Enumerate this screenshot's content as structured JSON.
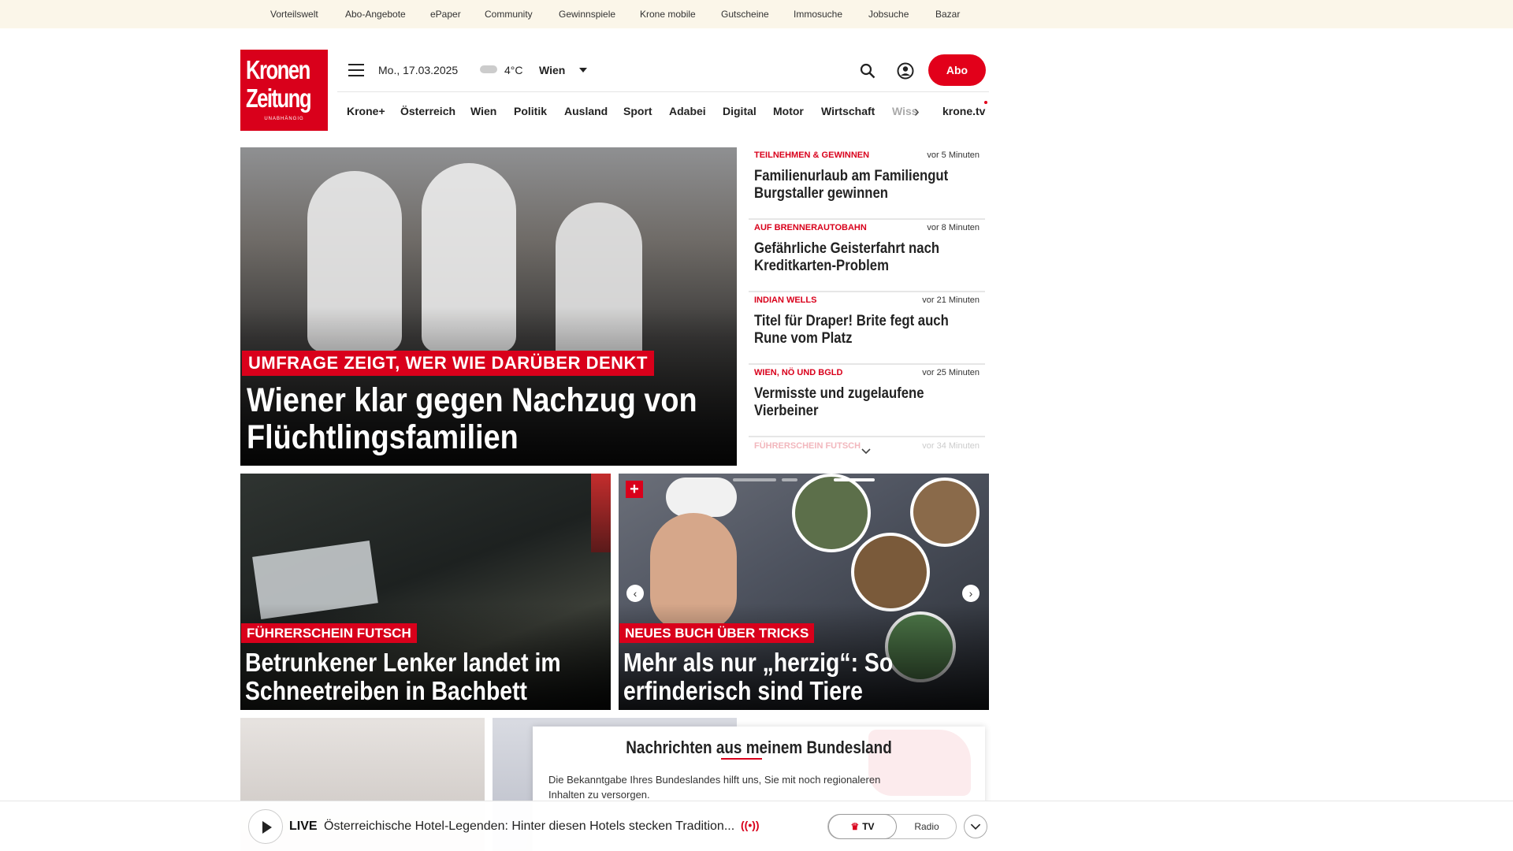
{
  "topnav": [
    "Vorteilswelt",
    "Abo-Angebote",
    "ePaper",
    "Community",
    "Gewinnspiele",
    "Krone mobile",
    "Gutscheine",
    "Immosuche",
    "Jobsuche",
    "Bazar"
  ],
  "logo": {
    "line1": "Kronen",
    "line2": "Zeitung",
    "tagline": "UNABHÄNGIG"
  },
  "header": {
    "date": "Mo., 17.03.2025",
    "temperature": "4°C",
    "location": "Wien",
    "abo_label": "Abo"
  },
  "mainnav": [
    "Krone+",
    "Österreich",
    "Wien",
    "Politik",
    "Ausland",
    "Sport",
    "Adabei",
    "Digital",
    "Motor",
    "Wirtschaft",
    "Wiss"
  ],
  "mainnav_tv": "krone.tv",
  "hero": {
    "kicker": "UMFRAGE ZEIGT, WER WIE DARÜBER DENKT",
    "title": "Wiener klar gegen Nachzug von Flüchtlingsfamilien"
  },
  "feed": [
    {
      "category": "TEILNEHMEN & GEWINNEN",
      "time": "vor 5 Minuten",
      "headline": "Familienurlaub am Familiengut Burgstaller gewinnen"
    },
    {
      "category": "AUF BRENNERAUTOBAHN",
      "time": "vor 8 Minuten",
      "headline": "Gefährliche Geisterfahrt nach Kreditkarten-Problem"
    },
    {
      "category": "INDIAN WELLS",
      "time": "vor 21 Minuten",
      "headline": "Titel für Draper! Brite fegt auch Rune vom Platz"
    },
    {
      "category": "WIEN, NÖ UND BGLD",
      "time": "vor 25 Minuten",
      "headline": "Vermisste und zugelaufene Vierbeiner"
    }
  ],
  "feed_partial": {
    "category": "FÜHRERSCHEIN FUTSCH",
    "time": "vor 34 Minuten"
  },
  "cards": [
    {
      "kicker": "FÜHRERSCHEIN FUTSCH",
      "title": "Betrunkener Lenker landet im Schneetreiben in Bachbett"
    },
    {
      "kicker": "NEUES BUCH ÜBER TRICKS",
      "title": "Mehr als nur „herzig“: So erfinderisch sind Tiere"
    }
  ],
  "plus_badge": "+",
  "bundesland_popup": {
    "title": "Nachrichten aus meinem Bundesland",
    "text": "Die Bekanntgabe Ihres Bundeslandes hilft uns, Sie mit noch regionaleren Inhalten zu versorgen."
  },
  "live_player": {
    "live_label": "LIVE",
    "text": "Österreichische Hotel-Legenden: Hinter diesen Hotels stecken Tradition...",
    "broadcast_icon": "((•))",
    "tv_label": "TV",
    "radio_label": "Radio"
  },
  "colors": {
    "brand_red": "#d9001b",
    "topbar_bg": "#fbf6e9"
  },
  "icons": [
    "menu-icon",
    "weather-cloud-icon",
    "chevron-down-icon",
    "search-icon",
    "user-icon",
    "chevron-right-icon",
    "play-icon",
    "broadcast-icon",
    "crown-icon"
  ]
}
